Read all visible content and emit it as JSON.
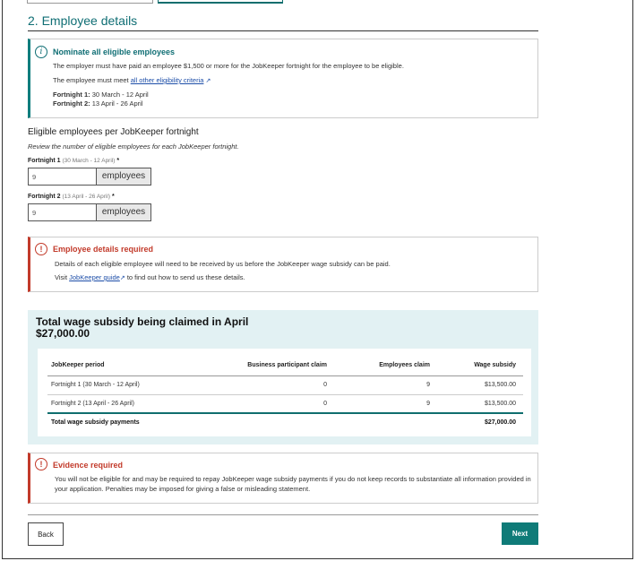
{
  "section": {
    "title": "2. Employee details"
  },
  "info": {
    "title": "Nominate all eligible employees",
    "line1": "The employer must have paid an employee $1,500 or more for the JobKeeper fortnight for the employee to be eligible.",
    "line2_prefix": "The employee must meet",
    "line2_link": "all other eligibility criteria",
    "f1_label": "Fortnight 1:",
    "f1_dates": "30 March - 12 April",
    "f2_label": "Fortnight 2:",
    "f2_dates": "13 April - 26 April"
  },
  "eligible": {
    "title": "Eligible employees per JobKeeper fortnight",
    "subtitle": "Review the number of eligible employees for each JobKeeper fortnight.",
    "f1_label": "Fortnight 1",
    "f1_dates": "(30 March - 12 April)",
    "f2_label": "Fortnight 2",
    "f2_dates": "(13 April - 26 April)",
    "required_mark": "*",
    "f1_value": "9",
    "f2_value": "9",
    "suffix": "employees"
  },
  "required_alert": {
    "title": "Employee details required",
    "line1": "Details of each eligible employee will need to be received by us before the JobKeeper wage subsidy can be paid.",
    "line2_prefix": "Visit",
    "line2_link": "JobKeeper guide",
    "line2_suffix": "to find out how to send us these details."
  },
  "summary": {
    "title": "Total wage subsidy being claimed in April",
    "amount": "$27,000.00",
    "columns": [
      "JobKeeper period",
      "Business participant claim",
      "Employees claim",
      "Wage subsidy"
    ],
    "rows": [
      [
        "Fortnight 1 (30 March - 12 April)",
        "0",
        "9",
        "$13,500.00"
      ],
      [
        "Fortnight 2 (13 April - 26 April)",
        "0",
        "9",
        "$13,500.00"
      ]
    ],
    "total_label": "Total wage subsidy payments",
    "total_value": "$27,000.00"
  },
  "evidence_alert": {
    "title": "Evidence required",
    "text": "You will not be eligible for and may be required to repay JobKeeper wage subsidy payments if you do not keep records to substantiate all information provided in your application. Penalties may be imposed for giving a false or misleading statement."
  },
  "buttons": {
    "back": "Back",
    "next": "Next"
  },
  "icons": {
    "info": "info-icon",
    "alert": "alert-icon",
    "external": "external-link-icon"
  },
  "colors": {
    "accent": "#0f6e74",
    "error": "#c23a2a",
    "summary_bg": "#e2f1f3"
  }
}
